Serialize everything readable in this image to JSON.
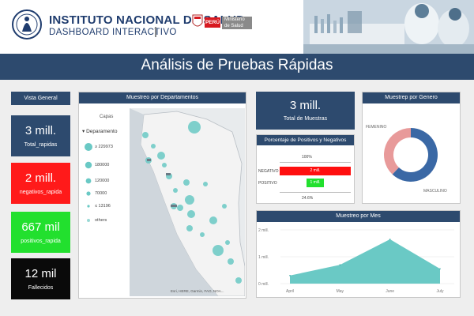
{
  "header": {
    "org_title": "INSTITUTO NACIONAL DE SALUD",
    "org_subtitle": "DASHBOARD INTERACTIVO",
    "peru_badge": "PERÚ",
    "ministry_line1": "Ministerio",
    "ministry_line2": "de Salud"
  },
  "banner": {
    "title": "Análisis de Pruebas Rápidas"
  },
  "overview": {
    "header": "Vista General",
    "kpis": [
      {
        "value": "3 mill.",
        "label": "Total_rapidas",
        "color": "#2d4a6e"
      },
      {
        "value": "2 mill.",
        "label": "negativos_rapida",
        "color": "#ff1a1a"
      },
      {
        "value": "667 mil",
        "label": "positivos_rapida",
        "color": "#22e02e"
      },
      {
        "value": "12 mil",
        "label": "Fallecidos",
        "color": "#0a0a0a"
      }
    ]
  },
  "departments_map": {
    "header": "Muestreo por Departamentos",
    "layers_label": "Capas",
    "layer_name": "Deparamento",
    "legend": [
      "229973",
      "180000",
      "120000",
      "70000",
      "13196",
      "others"
    ],
    "attribution": "Esri, HERE, Garmin, FAO, NOA..."
  },
  "total_samples": {
    "value": "3 mill.",
    "label": "Total de Muestras"
  },
  "neg_pos": {
    "header": "Porcentaje de Positivos y  Negativos",
    "top_pct": "100%",
    "bottom_pct": "24.6%",
    "negativo_label": "NEGATIVO",
    "negativo_value": "2 mill.",
    "negativo_fraction": 1.0,
    "positivo_label": "POSITIVO",
    "positivo_value": "1 mill.",
    "positivo_fraction": 0.246
  },
  "gender": {
    "header": "Muestrep por Genero",
    "female_label": "FEMENINO",
    "male_label": "MASCULINO",
    "female_share": 0.38,
    "male_share": 0.62,
    "female_color": "#e89a9a",
    "male_color": "#3a68a5"
  },
  "chart_data": {
    "type": "area",
    "title": "Muestreo por Mes",
    "categories": [
      "April",
      "May",
      "June",
      "July"
    ],
    "values": [
      0.3,
      0.7,
      1.65,
      0.55
    ],
    "yticks": [
      "0 mill.",
      "1 mill.",
      "2 mill."
    ],
    "ylim": [
      0,
      2
    ],
    "color": "#6ac9c5"
  }
}
